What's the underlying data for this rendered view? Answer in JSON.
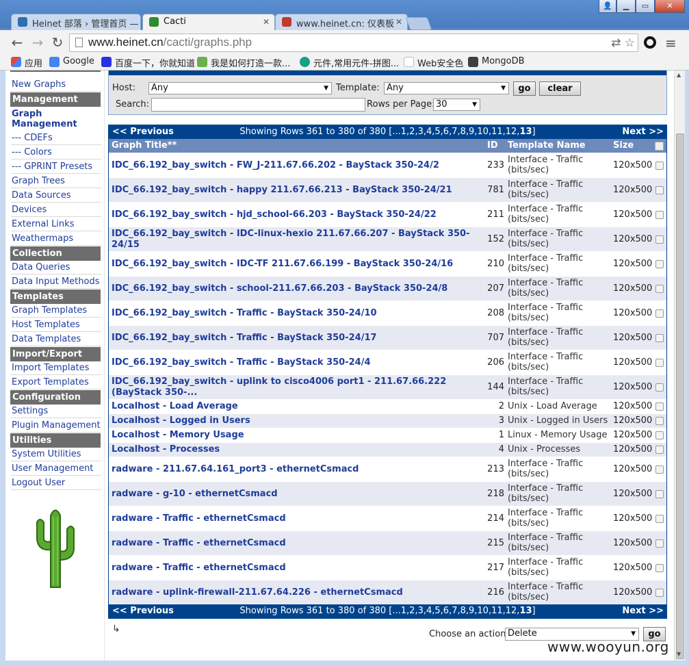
{
  "browser": {
    "tabs": [
      {
        "label": "Heinet 部落 › 管理首页 —",
        "color": "#2f6fb2"
      },
      {
        "label": "Cacti",
        "color": "#2e8b30"
      },
      {
        "label": "www.heinet.cn: 仪表板",
        "color": "#c0392b"
      }
    ],
    "url_host": "www.heinet.cn",
    "url_path": "/cacti/graphs.php",
    "bookmarks": [
      {
        "label": "应用",
        "icon": "apps-grid-icon",
        "color": "#e04a3a"
      },
      {
        "label": "Google",
        "icon": "google-icon",
        "color": "#4285f4"
      },
      {
        "label": "百度一下，你就知道",
        "icon": "baidu-paw-icon",
        "color": "#2932e1"
      },
      {
        "label": "我是如何打造一款...",
        "icon": "f-logo-icon",
        "color": "#6ab04c"
      },
      {
        "label": "元件,常用元件-拼图...",
        "icon": "p-circle-icon",
        "color": "#16a085"
      },
      {
        "label": "Web安全色",
        "icon": "page-icon",
        "color": "#bbbbbb"
      },
      {
        "label": "MongoDB",
        "icon": "mongodb-leaf-icon",
        "color": "#3f3f3f"
      }
    ]
  },
  "sidebar": {
    "items": [
      {
        "type": "link",
        "label": "New Graphs"
      },
      {
        "type": "head",
        "label": "Management"
      },
      {
        "type": "active",
        "label": "Graph Management"
      },
      {
        "type": "link",
        "label": "--- CDEFs"
      },
      {
        "type": "link",
        "label": "--- Colors"
      },
      {
        "type": "link",
        "label": "--- GPRINT Presets"
      },
      {
        "type": "link",
        "label": "Graph Trees"
      },
      {
        "type": "link",
        "label": "Data Sources"
      },
      {
        "type": "link",
        "label": "Devices"
      },
      {
        "type": "link",
        "label": "External Links"
      },
      {
        "type": "link",
        "label": "Weathermaps"
      },
      {
        "type": "head",
        "label": "Collection Methods"
      },
      {
        "type": "link",
        "label": "Data Queries"
      },
      {
        "type": "link",
        "label": "Data Input Methods"
      },
      {
        "type": "head",
        "label": "Templates"
      },
      {
        "type": "link",
        "label": "Graph Templates"
      },
      {
        "type": "link",
        "label": "Host Templates"
      },
      {
        "type": "link",
        "label": "Data Templates"
      },
      {
        "type": "head",
        "label": "Import/Export"
      },
      {
        "type": "link",
        "label": "Import Templates"
      },
      {
        "type": "link",
        "label": "Export Templates"
      },
      {
        "type": "head",
        "label": "Configuration"
      },
      {
        "type": "link",
        "label": "Settings"
      },
      {
        "type": "link",
        "label": "Plugin Management"
      },
      {
        "type": "head",
        "label": "Utilities"
      },
      {
        "type": "link",
        "label": "System Utilities"
      },
      {
        "type": "link",
        "label": "User Management"
      },
      {
        "type": "link",
        "label": "Logout User"
      }
    ]
  },
  "filter": {
    "host_label": "Host:",
    "host_value": "Any",
    "template_label": "Template:",
    "template_value": "Any",
    "go_label": "go",
    "clear_label": "clear",
    "search_label": "Search:",
    "search_value": "",
    "rows_label": "Rows per Page:",
    "rows_value": "30"
  },
  "nav": {
    "prev": "<< Previous",
    "showing": "Showing Rows 361 to 380 of 380 [...1,2,3,4,5,6,7,8,9,10,11,12,",
    "current_page": "13",
    "showing_end": "]",
    "next": "Next >>"
  },
  "columns": {
    "title": "Graph Title**",
    "id": "ID",
    "template": "Template Name",
    "size": "Size"
  },
  "rows": [
    {
      "title": "IDC_66.192_bay_switch - FW_J-211.67.66.202 - BayStack 350-24/2",
      "id": "233",
      "template": "Interface - Traffic (bits/sec)",
      "size": "120x500"
    },
    {
      "title": "IDC_66.192_bay_switch - happy 211.67.66.213 - BayStack 350-24/21",
      "id": "781",
      "template": "Interface - Traffic (bits/sec)",
      "size": "120x500"
    },
    {
      "title": "IDC_66.192_bay_switch - hjd_school-66.203 - BayStack 350-24/22",
      "id": "211",
      "template": "Interface - Traffic (bits/sec)",
      "size": "120x500"
    },
    {
      "title": "IDC_66.192_bay_switch - IDC-linux-hexio 211.67.66.207 - BayStack 350-24/15",
      "id": "152",
      "template": "Interface - Traffic (bits/sec)",
      "size": "120x500"
    },
    {
      "title": "IDC_66.192_bay_switch - IDC-TF 211.67.66.199 - BayStack 350-24/16",
      "id": "210",
      "template": "Interface - Traffic (bits/sec)",
      "size": "120x500"
    },
    {
      "title": "IDC_66.192_bay_switch - school-211.67.66.203 - BayStack 350-24/8",
      "id": "207",
      "template": "Interface - Traffic (bits/sec)",
      "size": "120x500"
    },
    {
      "title": "IDC_66.192_bay_switch - Traffic - BayStack 350-24/10",
      "id": "208",
      "template": "Interface - Traffic (bits/sec)",
      "size": "120x500"
    },
    {
      "title": "IDC_66.192_bay_switch - Traffic - BayStack 350-24/17",
      "id": "707",
      "template": "Interface - Traffic (bits/sec)",
      "size": "120x500"
    },
    {
      "title": "IDC_66.192_bay_switch - Traffic - BayStack 350-24/4",
      "id": "206",
      "template": "Interface - Traffic (bits/sec)",
      "size": "120x500"
    },
    {
      "title": "IDC_66.192_bay_switch - uplink to cisco4006 port1 - 211.67.66.222 (BayStack 350-...",
      "id": "144",
      "template": "Interface - Traffic (bits/sec)",
      "size": "120x500"
    },
    {
      "title": "Localhost - Load Average",
      "id": "2",
      "template": "Unix - Load Average",
      "size": "120x500"
    },
    {
      "title": "Localhost - Logged in Users",
      "id": "3",
      "template": "Unix - Logged in Users",
      "size": "120x500"
    },
    {
      "title": "Localhost - Memory Usage",
      "id": "1",
      "template": "Linux - Memory Usage",
      "size": "120x500"
    },
    {
      "title": "Localhost - Processes",
      "id": "4",
      "template": "Unix - Processes",
      "size": "120x500"
    },
    {
      "title": "radware - 211.67.64.161_port3 - ethernetCsmacd",
      "id": "213",
      "template": "Interface - Traffic (bits/sec)",
      "size": "120x500"
    },
    {
      "title": "radware - g-10 - ethernetCsmacd",
      "id": "218",
      "template": "Interface - Traffic (bits/sec)",
      "size": "120x500"
    },
    {
      "title": "radware - Traffic - ethernetCsmacd",
      "id": "214",
      "template": "Interface - Traffic (bits/sec)",
      "size": "120x500"
    },
    {
      "title": "radware - Traffic - ethernetCsmacd",
      "id": "215",
      "template": "Interface - Traffic (bits/sec)",
      "size": "120x500"
    },
    {
      "title": "radware - Traffic - ethernetCsmacd",
      "id": "217",
      "template": "Interface - Traffic (bits/sec)",
      "size": "120x500"
    },
    {
      "title": "radware - uplink-firewall-211.67.64.226 - ethernetCsmacd",
      "id": "216",
      "template": "Interface - Traffic (bits/sec)",
      "size": "120x500"
    }
  ],
  "action": {
    "label": "Choose an action:",
    "value": "Delete",
    "go_label": "go"
  },
  "watermark": "www.wooyun.org",
  "colors": {
    "header_blue": "#00438c",
    "column_header": "#6d8abb",
    "link": "#1f3d9a",
    "section_gray": "#6d6d6d"
  }
}
